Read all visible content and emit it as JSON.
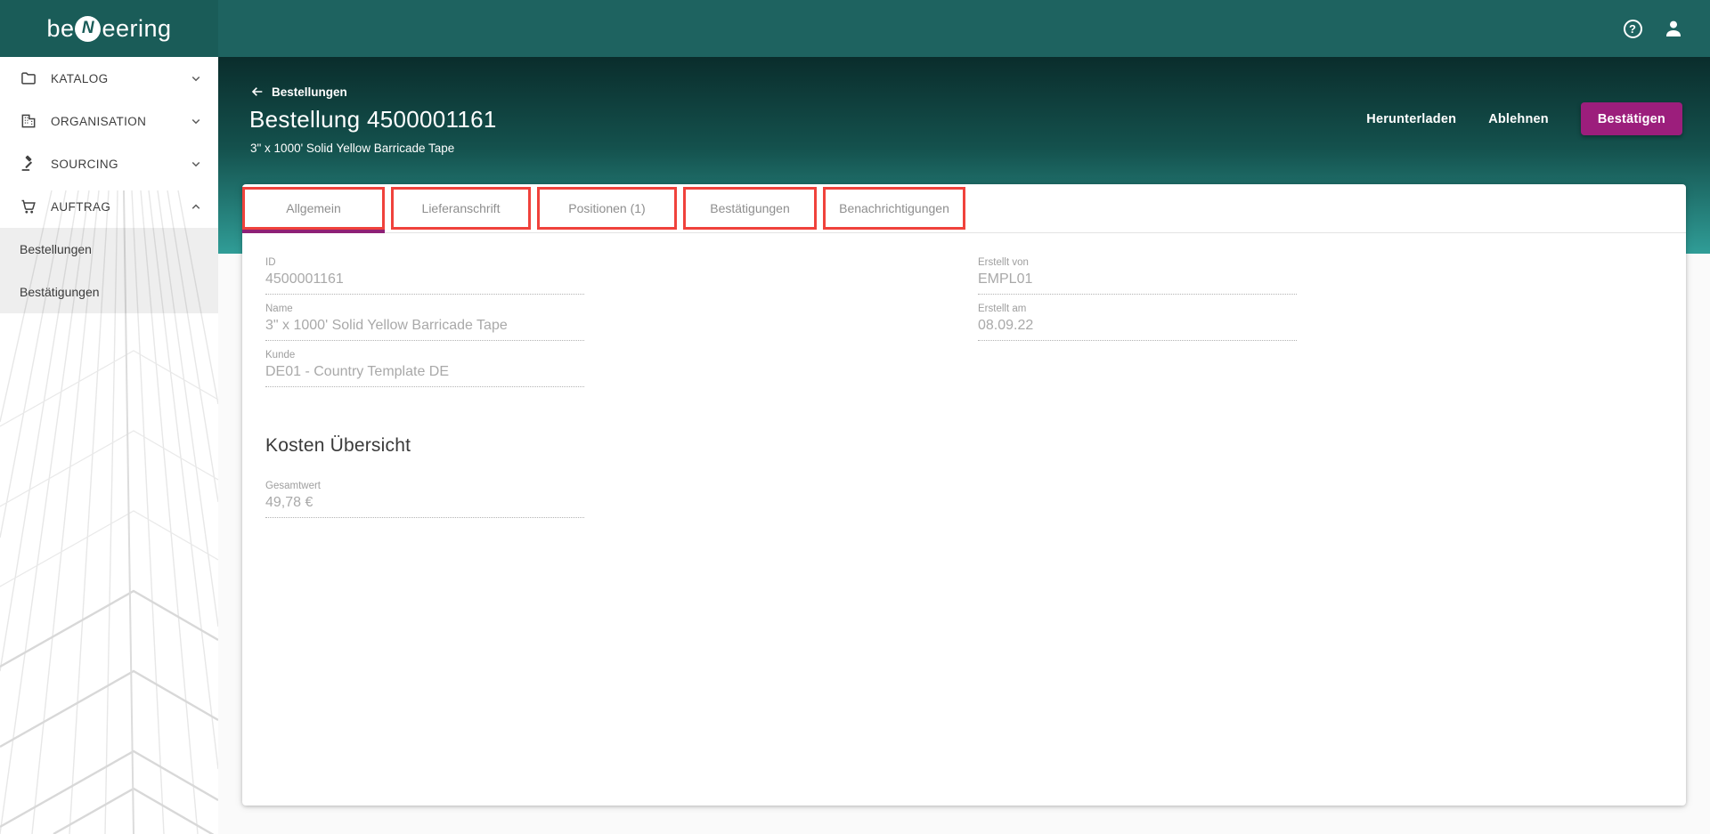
{
  "colors": {
    "brand_teal_dark": "#1a5c58",
    "brand_teal": "#1e6360",
    "hero_gradient_top": "#0a2d2c",
    "hero_gradient_bottom": "#309d97",
    "accent_magenta": "#9c1e7c",
    "active_tab_underline": "#8e2076",
    "annotation_red": "#f0423c"
  },
  "app_bar": {
    "logo_pre": "be",
    "logo_n": "N",
    "logo_post": "eering",
    "help_glyph": "?",
    "icons": [
      "help-icon",
      "person-icon"
    ]
  },
  "sidebar": {
    "items": [
      {
        "label": "KATALOG",
        "icon": "folder-icon",
        "expanded": false
      },
      {
        "label": "ORGANISATION",
        "icon": "building-icon",
        "expanded": false
      },
      {
        "label": "SOURCING",
        "icon": "gavel-icon",
        "expanded": false
      },
      {
        "label": "AUFTRAG",
        "icon": "cart-icon",
        "expanded": true
      }
    ],
    "auftrag_children": [
      {
        "label": "Bestellungen"
      },
      {
        "label": "Bestätigungen"
      }
    ]
  },
  "header": {
    "back_label": "Bestellungen",
    "title": "Bestellung 4500001161",
    "subtitle": "3\" x 1000' Solid Yellow Barricade Tape",
    "actions": [
      {
        "label": "Herunterladen",
        "style": "text"
      },
      {
        "label": "Ablehnen",
        "style": "text"
      },
      {
        "label": "Bestätigen",
        "style": "raised"
      }
    ]
  },
  "tabs": [
    {
      "label": "Allgemein",
      "active": true
    },
    {
      "label": "Lieferanschrift",
      "active": false
    },
    {
      "label": "Positionen (1)",
      "active": false
    },
    {
      "label": "Bestätigungen",
      "active": false
    },
    {
      "label": "Benachrichtigungen",
      "active": false
    }
  ],
  "form": {
    "fields_left": [
      {
        "label": "ID",
        "value": "4500001161"
      },
      {
        "label": "Name",
        "value": "3\" x 1000' Solid Yellow Barricade Tape"
      },
      {
        "label": "Kunde",
        "value": "DE01 - Country Template DE"
      }
    ],
    "fields_right": [
      {
        "label": "Erstellt von",
        "value": "EMPL01"
      },
      {
        "label": "Erstellt am",
        "value": "08.09.22"
      }
    ],
    "section_title": "Kosten Übersicht",
    "cost_fields": [
      {
        "label": "Gesamtwert",
        "value": "49,78 €"
      }
    ]
  }
}
